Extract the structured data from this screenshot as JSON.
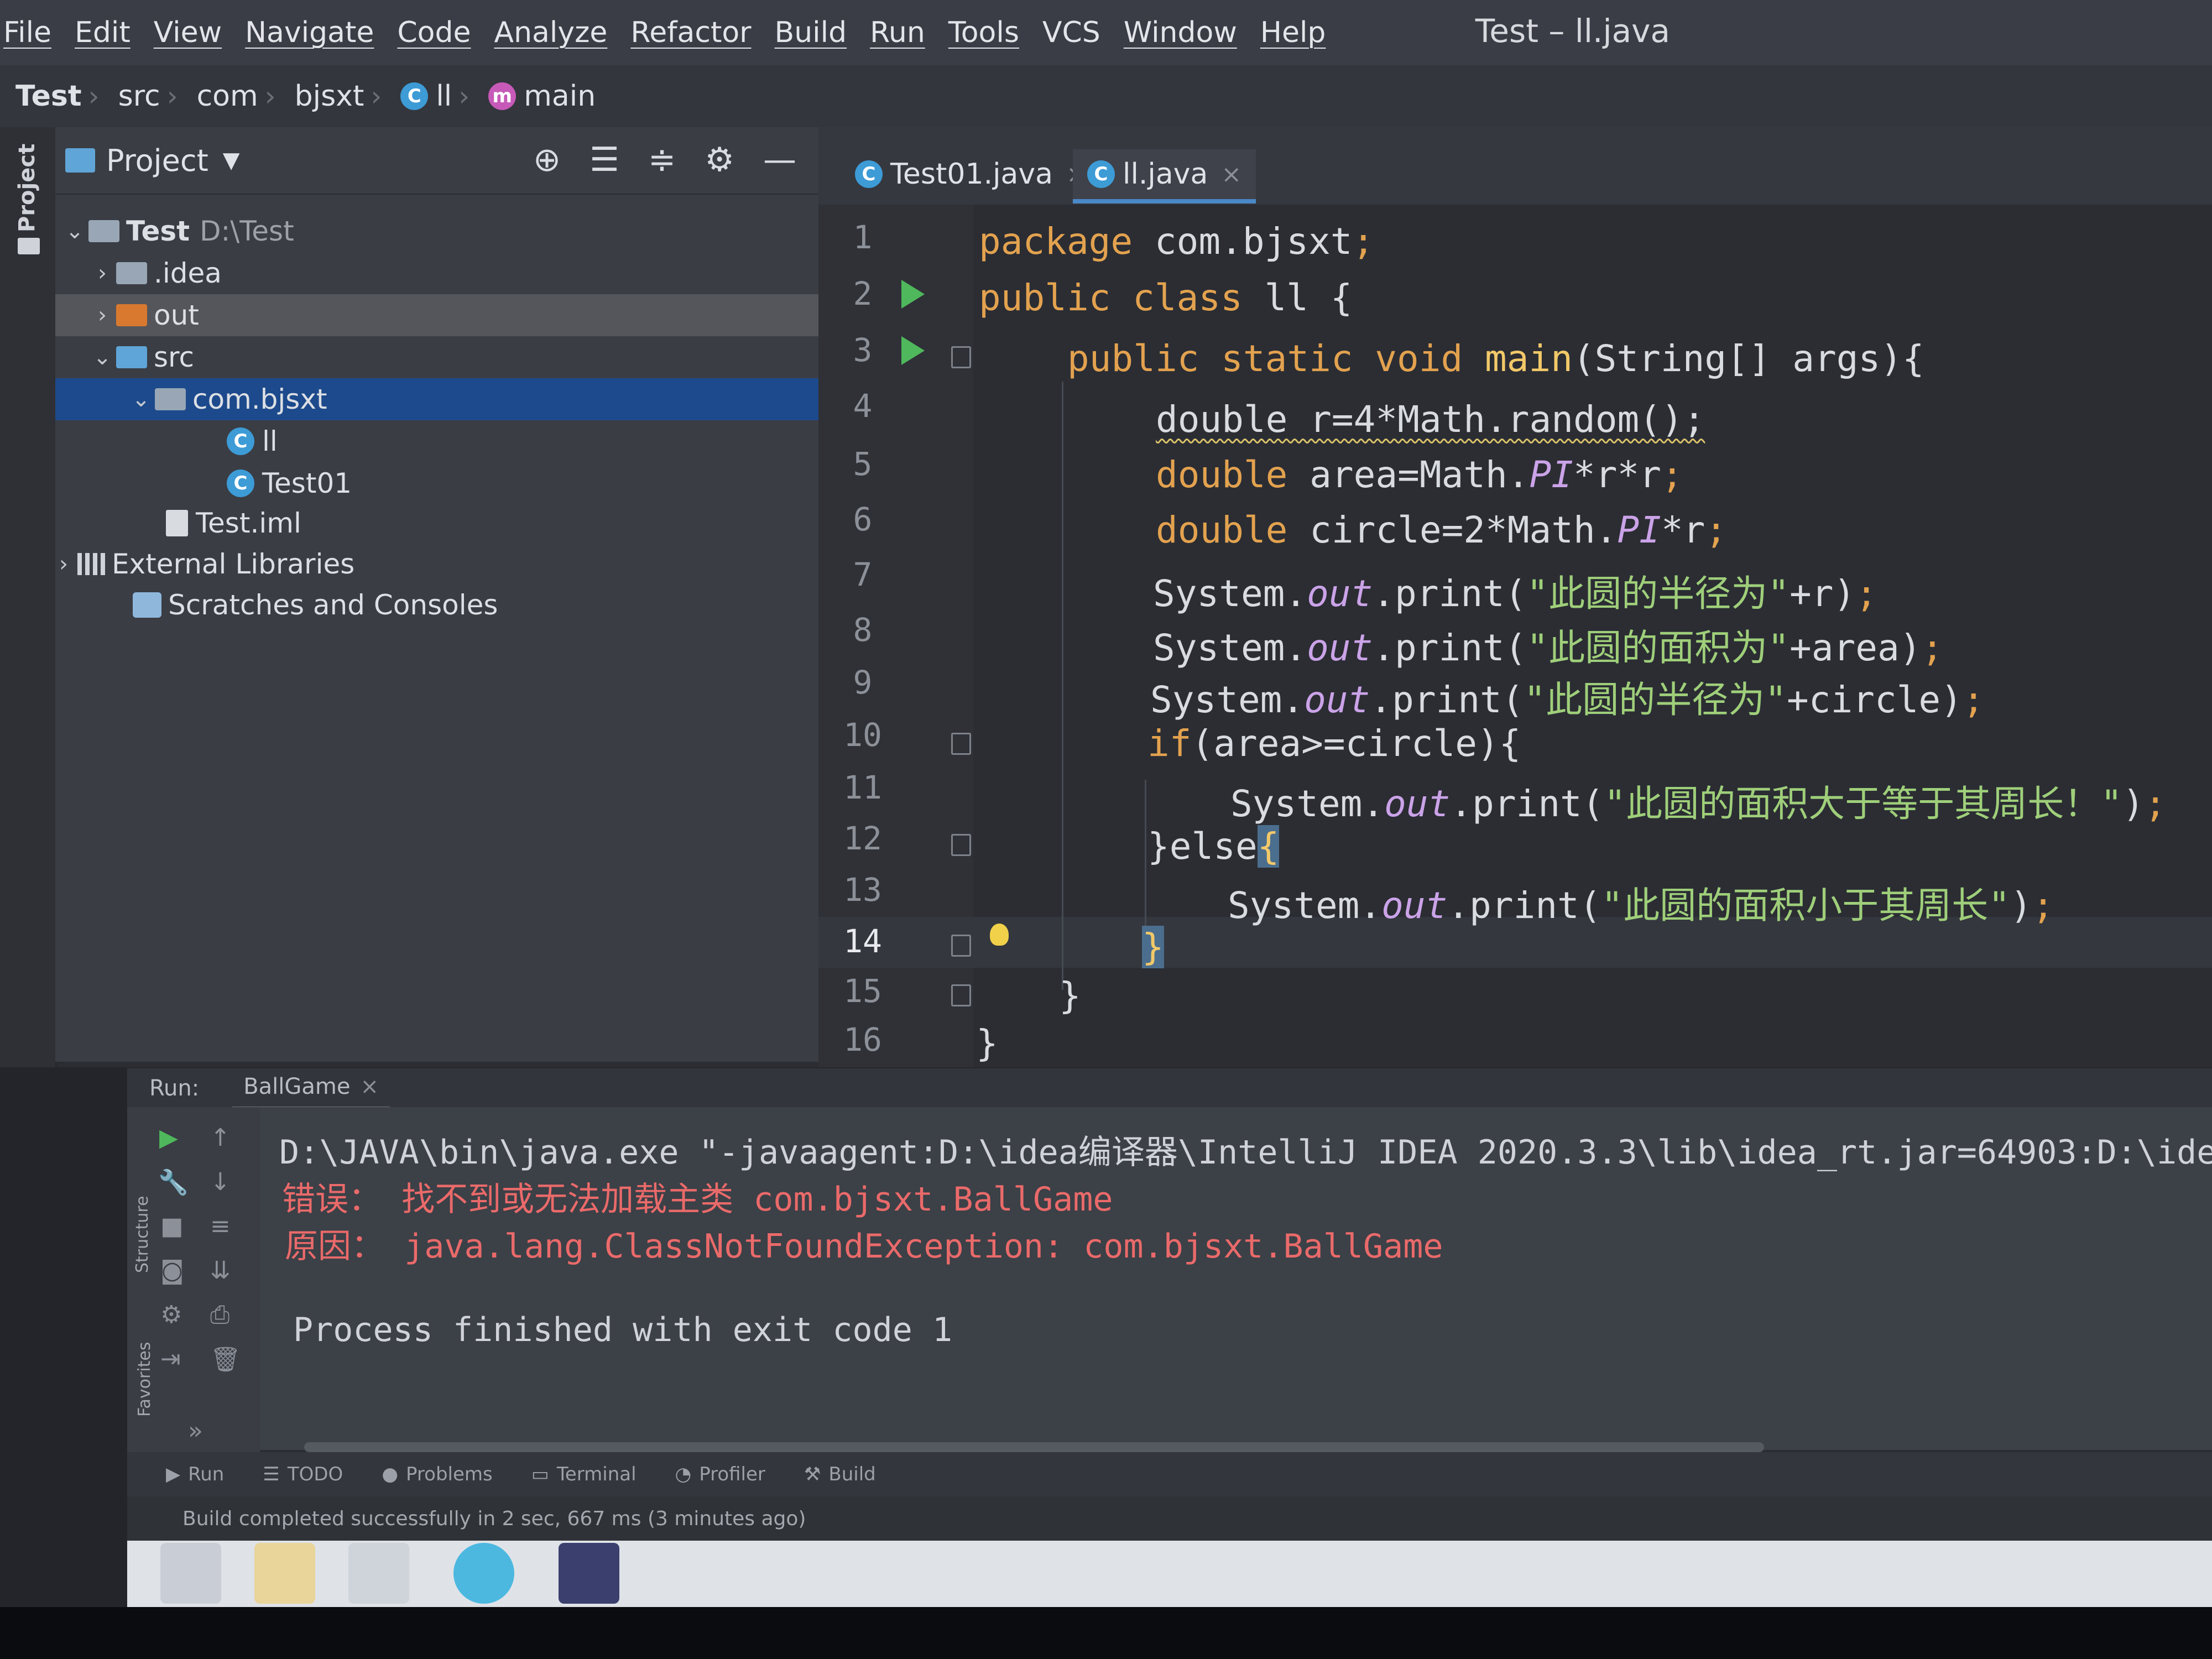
{
  "window_title": "Test – ll.java",
  "menu": [
    "File",
    "Edit",
    "View",
    "Navigate",
    "Code",
    "Analyze",
    "Refactor",
    "Build",
    "Run",
    "Tools",
    "VCS",
    "Window",
    "Help"
  ],
  "breadcrumbs": [
    "Test",
    "src",
    "com",
    "bjsxt",
    "ll",
    "main"
  ],
  "left_strip": {
    "project_label": "Project",
    "structure_label": "Structure",
    "favorites_label": "Favorites"
  },
  "project_panel": {
    "title": "Project",
    "tree": [
      {
        "label": "Test",
        "extra": "D:\\Test",
        "level": 0,
        "expanded": true
      },
      {
        "label": ".idea",
        "level": 1,
        "expanded": false
      },
      {
        "label": "out",
        "level": 1,
        "expanded": false
      },
      {
        "label": "src",
        "level": 1,
        "expanded": true
      },
      {
        "label": "com.bjsxt",
        "level": 2,
        "expanded": true
      },
      {
        "label": "ll",
        "level": 3
      },
      {
        "label": "Test01",
        "level": 3
      },
      {
        "label": "Test.iml",
        "level": 1
      },
      {
        "label": "External Libraries",
        "level": 0,
        "expanded": false
      },
      {
        "label": "Scratches and Consoles",
        "level": 0
      }
    ]
  },
  "editor_tabs": [
    {
      "label": "Test01.java",
      "active": false
    },
    {
      "label": "ll.java",
      "active": true
    }
  ],
  "code": {
    "line_numbers": [
      "1",
      "2",
      "3",
      "4",
      "5",
      "6",
      "7",
      "8",
      "9",
      "10",
      "11",
      "12",
      "13",
      "14",
      "15",
      "16"
    ],
    "current_line": "14",
    "lines": {
      "l1_kw": "package",
      "l1_rest": " com.bjsxt",
      "semi": ";",
      "l2_kw": "public class",
      "l2_rest": " ll {",
      "l3_kw": "public static void",
      "l3_fn": " main",
      "l3_rest": "(String[] args){",
      "l4": "double r=4*Math.random();",
      "l5_kw": "double",
      "l5_a": " area=Math.",
      "l5_it": "PI",
      "l5_b": "*r*r",
      "l6_kw": "double",
      "l6_a": " circle=2*Math.",
      "l6_it": "PI",
      "l6_b": "*r",
      "sys": "System.",
      "out": "out",
      "print": ".print(",
      "l7_str": "\"此圆的半径为\"",
      "l7_b": "+r)",
      "l8_str": "\"此圆的面积为\"",
      "l8_b": "+area)",
      "l9_str": "\"此圆的半径为\"",
      "l9_b": "+circle)",
      "l10_kw": "if",
      "l10_rest": "(area>=circle){",
      "l11_str": "\"此圆的面积大于等于其周长！\"",
      "l11_b": ")",
      "l12_a": "}else",
      "l12_b": "{",
      "l13_str": "\"此圆的面积小于其周长\"",
      "l13_b": ")",
      "l14": "}",
      "l15": "}",
      "l16": "}"
    }
  },
  "run_panel": {
    "label": "Run:",
    "tab": "BallGame",
    "output": [
      {
        "text": "D:\\JAVA\\bin\\java.exe \"-javaagent:D:\\idea编译器\\IntelliJ IDEA 2020.3.3\\lib\\idea_rt.jar=64903:D:\\ide",
        "type": "gray"
      },
      {
        "text": "错误： 找不到或无法加载主类 com.bjsxt.BallGame",
        "type": "red"
      },
      {
        "text": "原因： java.lang.ClassNotFoundException: com.bjsxt.BallGame",
        "type": "red"
      },
      {
        "text": "Process finished with exit code 1",
        "type": "gray"
      }
    ]
  },
  "bottom_tabs": [
    "Run",
    "TODO",
    "Problems",
    "Terminal",
    "Profiler",
    "Build"
  ],
  "status_text": "Build completed successfully in 2 sec, 667 ms (3 minutes ago)",
  "colors": {
    "keyword": "#e3a24f",
    "string": "#9fcf7a",
    "error": "#ea6a6a",
    "selection": "#1d4a8c",
    "run_marker": "#4fb85c"
  }
}
